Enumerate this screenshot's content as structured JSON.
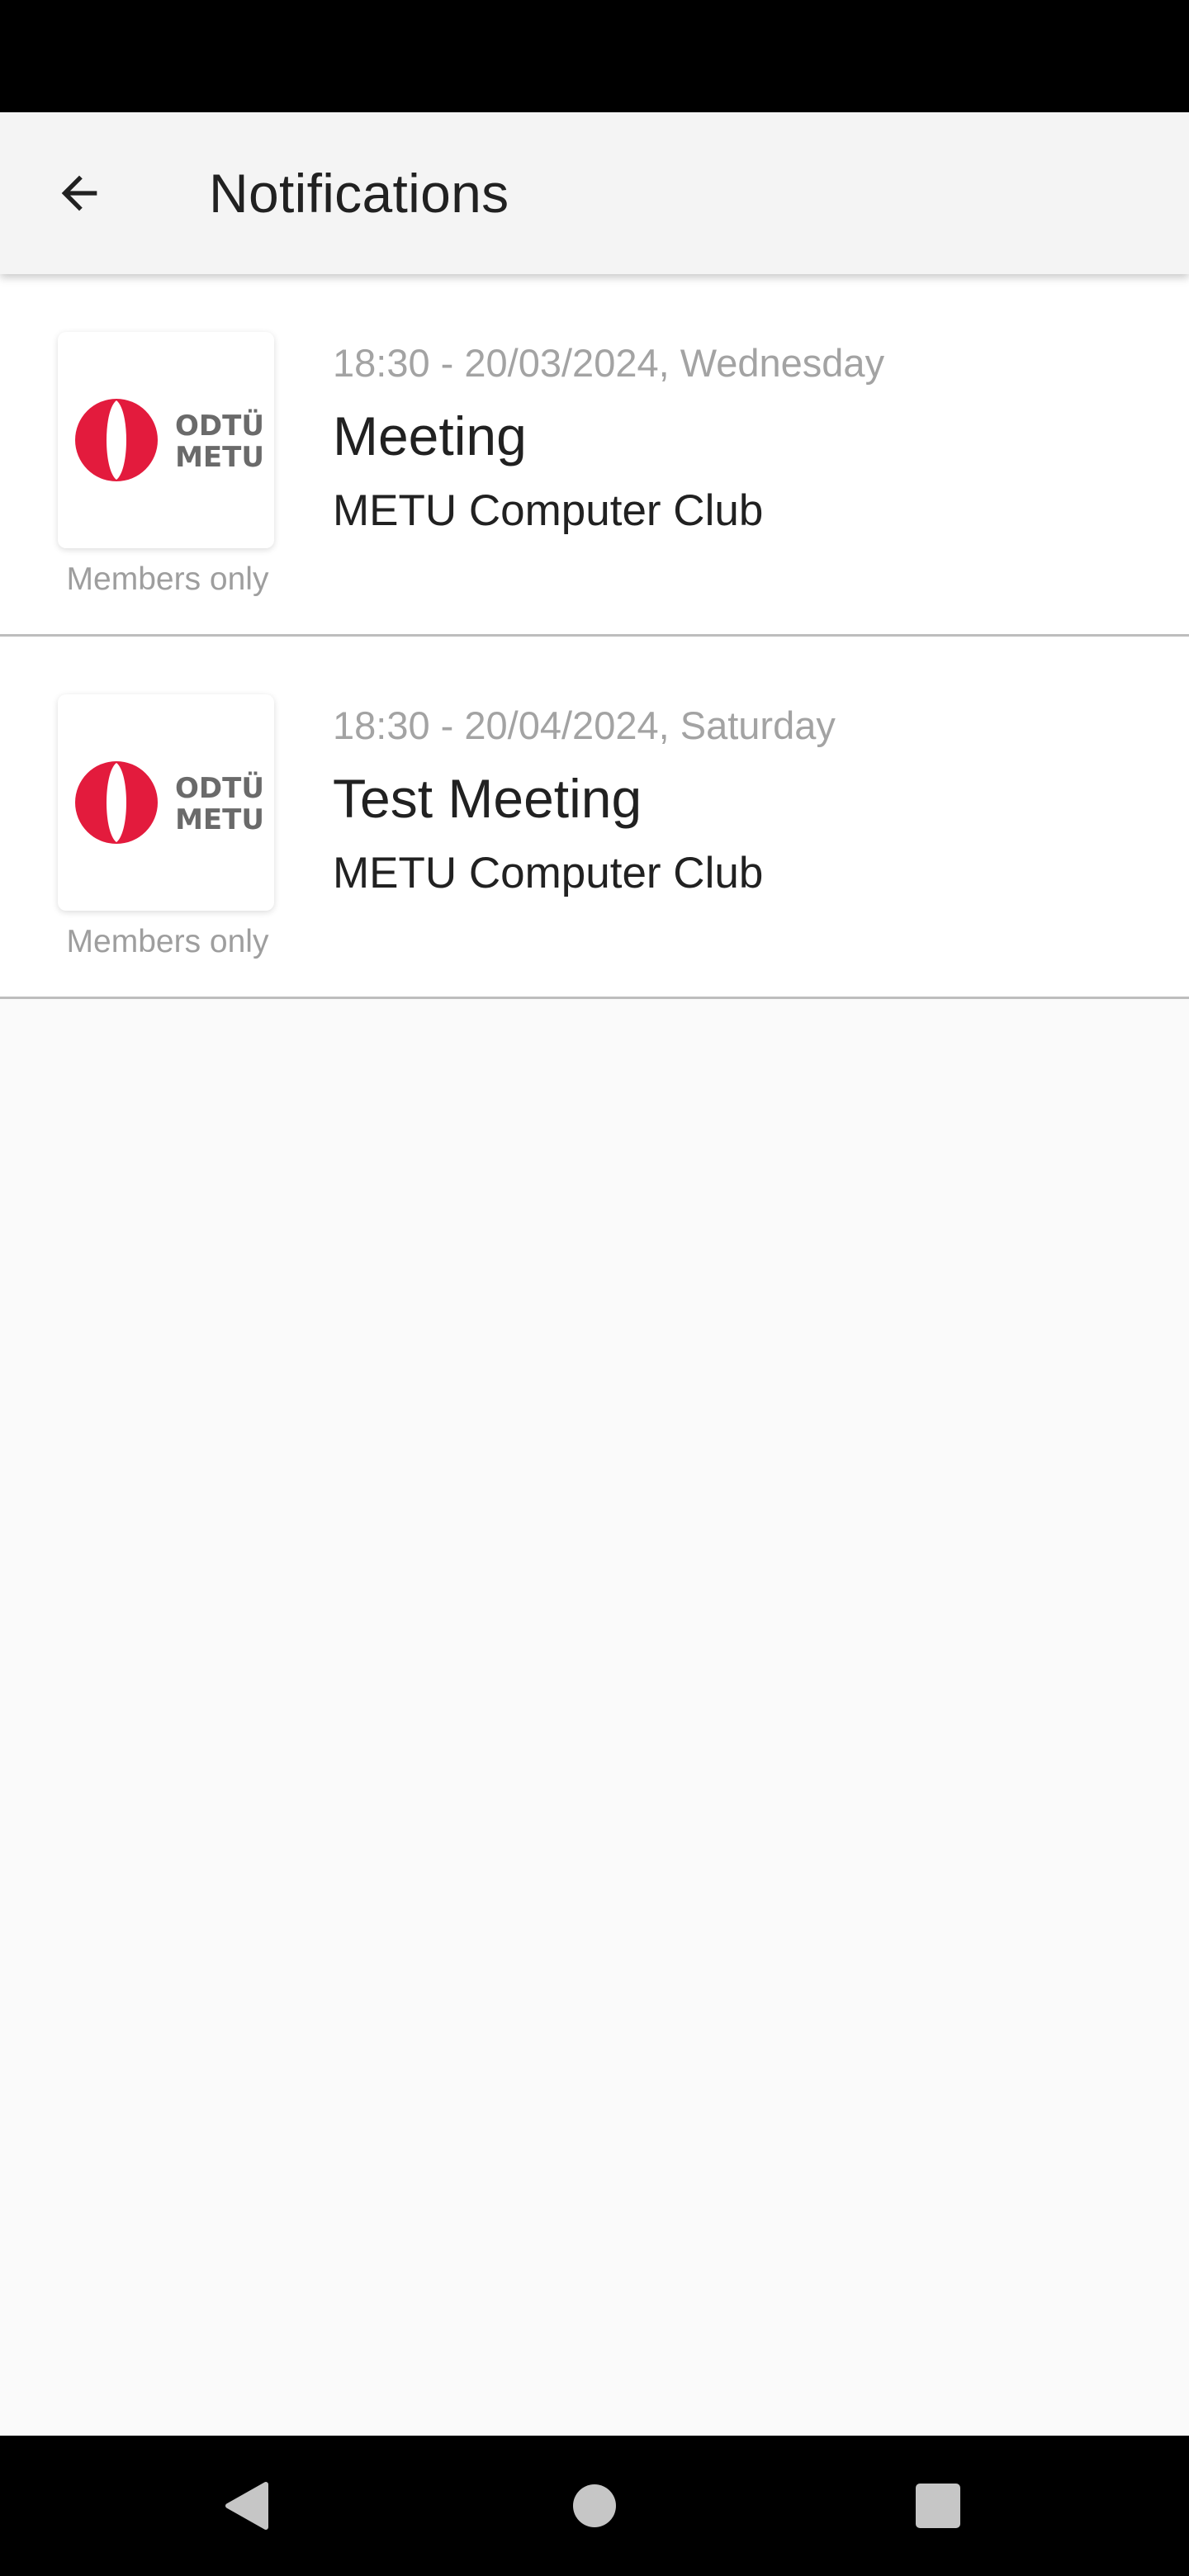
{
  "header": {
    "title": "Notifications",
    "back_icon": "arrow-left-icon"
  },
  "notifications": [
    {
      "datetime": "18:30 - 20/03/2024, Wednesday",
      "title": "Meeting",
      "club": "METU Computer Club",
      "visibility": "Members only",
      "logo": {
        "line1": "ODTÜ",
        "line2": "METU"
      }
    },
    {
      "datetime": "18:30 - 20/04/2024, Saturday",
      "title": "Test Meeting",
      "club": "METU Computer Club",
      "visibility": "Members only",
      "logo": {
        "line1": "ODTÜ",
        "line2": "METU"
      }
    }
  ],
  "navigation_bar": {
    "buttons": [
      "back-triangle-icon",
      "home-circle-icon",
      "recents-square-icon"
    ]
  },
  "colors": {
    "logo_red": "#e31b3d",
    "logo_text": "#6a6a6a",
    "secondary_text": "#a3a3a3",
    "app_bar": "#f4f4f4"
  }
}
